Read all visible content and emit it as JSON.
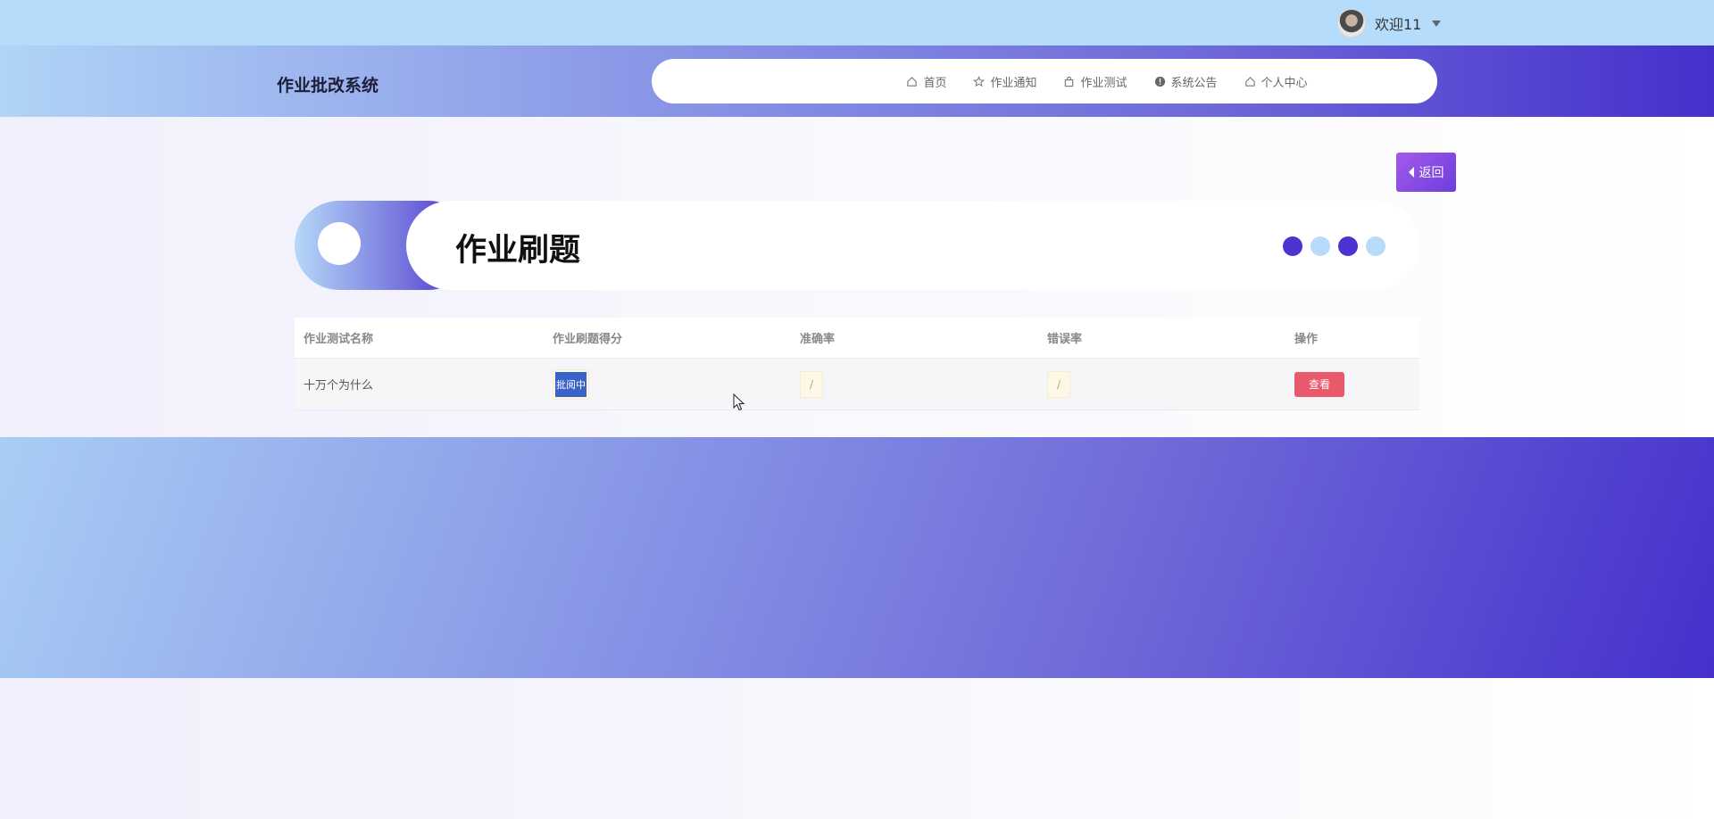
{
  "header": {
    "brand": "作业批改系统",
    "welcome": "欢迎11",
    "nav": [
      {
        "label": "首页",
        "icon": "home-icon"
      },
      {
        "label": "作业通知",
        "icon": "star-icon"
      },
      {
        "label": "作业测试",
        "icon": "bag-icon"
      },
      {
        "label": "系统公告",
        "icon": "info-icon"
      },
      {
        "label": "个人中心",
        "icon": "home-icon"
      }
    ]
  },
  "back_label": "返回",
  "banner": {
    "title": "作业刷题",
    "dot_colors": [
      "#4a33cf",
      "#b8dbfa",
      "#4a33cf",
      "#b8dbfa"
    ]
  },
  "table": {
    "columns": [
      "作业测试名称",
      "作业刷题得分",
      "准确率",
      "错误率",
      "操作"
    ],
    "rows": [
      {
        "name": "十万个为什么",
        "score": "批阅中",
        "accuracy": "/",
        "error_rate": "/",
        "action": "查看"
      }
    ]
  },
  "colors": {
    "topbar": "#b6dcfb",
    "accent": "#4530cc",
    "view_button": "#e8596b",
    "back_button": "#8a4be3"
  }
}
